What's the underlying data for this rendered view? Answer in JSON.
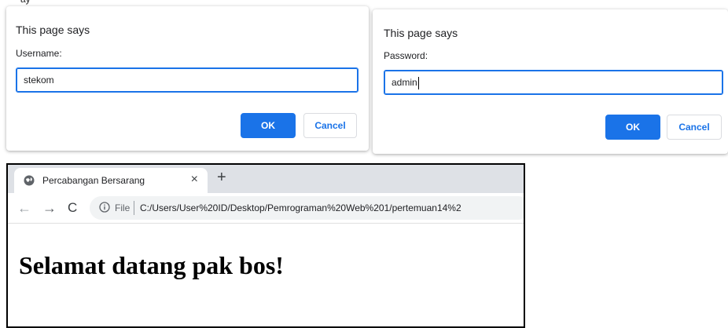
{
  "top_strip": {
    "text": "ay"
  },
  "dialog_username": {
    "title": "This page says",
    "label": "Username:",
    "value": "stekom",
    "ok_label": "OK",
    "cancel_label": "Cancel"
  },
  "dialog_password": {
    "title": "This page says",
    "label": "Password:",
    "value": "admin",
    "ok_label": "OK",
    "cancel_label": "Cancel"
  },
  "browser": {
    "tab_title": "Percabangan Bersarang",
    "tab_close": "×",
    "new_tab": "+",
    "back": "←",
    "forward": "→",
    "reload": "C",
    "file_label": "File",
    "url": "C:/Users/User%20ID/Desktop/Pemrograman%20Web%201/pertemuan14%2",
    "page_heading": "Selamat datang pak bos!"
  },
  "colors": {
    "accent": "#1a73e8",
    "tabbar": "#dee1e6",
    "omnibox": "#f1f3f4"
  }
}
